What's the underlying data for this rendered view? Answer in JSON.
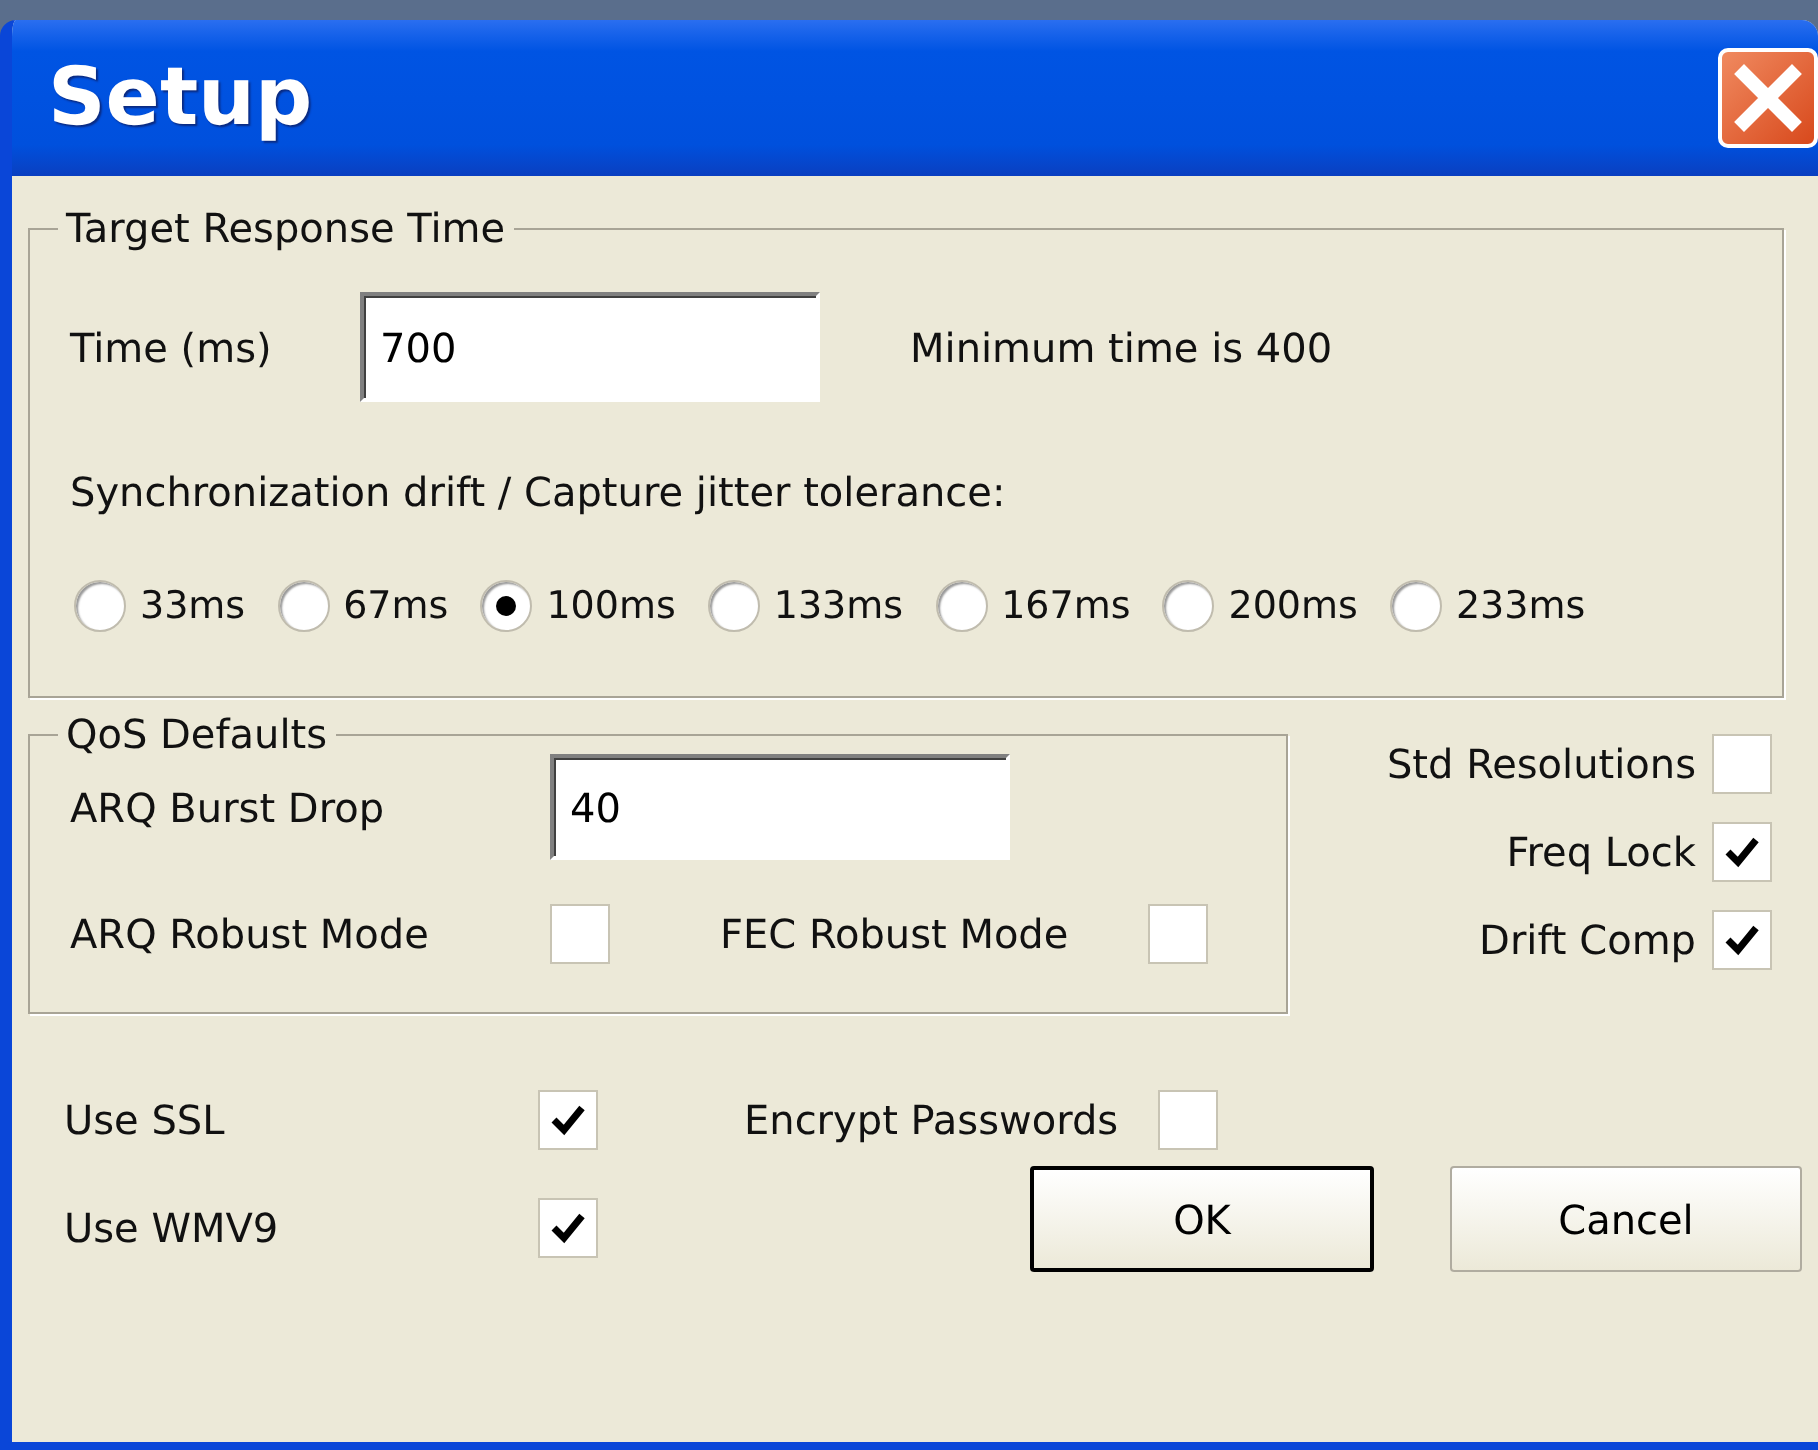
{
  "window": {
    "title": "Setup"
  },
  "target_group": {
    "legend": "Target Response Time",
    "time_label": "Time (ms)",
    "time_value": "700",
    "min_note": "Minimum time is 400",
    "drift_label": "Synchronization drift / Capture jitter tolerance:",
    "drift_options": [
      {
        "label": "33ms",
        "selected": false
      },
      {
        "label": "67ms",
        "selected": false
      },
      {
        "label": "100ms",
        "selected": true
      },
      {
        "label": "133ms",
        "selected": false
      },
      {
        "label": "167ms",
        "selected": false
      },
      {
        "label": "200ms",
        "selected": false
      },
      {
        "label": "233ms",
        "selected": false
      }
    ]
  },
  "qos_group": {
    "legend": "QoS Defaults",
    "burst_label": "ARQ Burst Drop",
    "burst_value": "40",
    "options": [
      {
        "label": "ARQ Robust Mode",
        "checked": false
      },
      {
        "label": "FEC Robust Mode",
        "checked": false
      }
    ]
  },
  "side_options": [
    {
      "label": "Std Resolutions",
      "checked": false
    },
    {
      "label": "Freq Lock",
      "checked": true
    },
    {
      "label": "Drift Comp",
      "checked": true
    }
  ],
  "bottom_options": [
    {
      "label": "Use SSL",
      "checked": true
    },
    {
      "label": "Use WMV9",
      "checked": true
    },
    {
      "label": "Encrypt Passwords",
      "checked": false
    }
  ],
  "buttons": [
    {
      "label": "OK",
      "default": true
    },
    {
      "label": "Cancel",
      "default": false
    }
  ]
}
